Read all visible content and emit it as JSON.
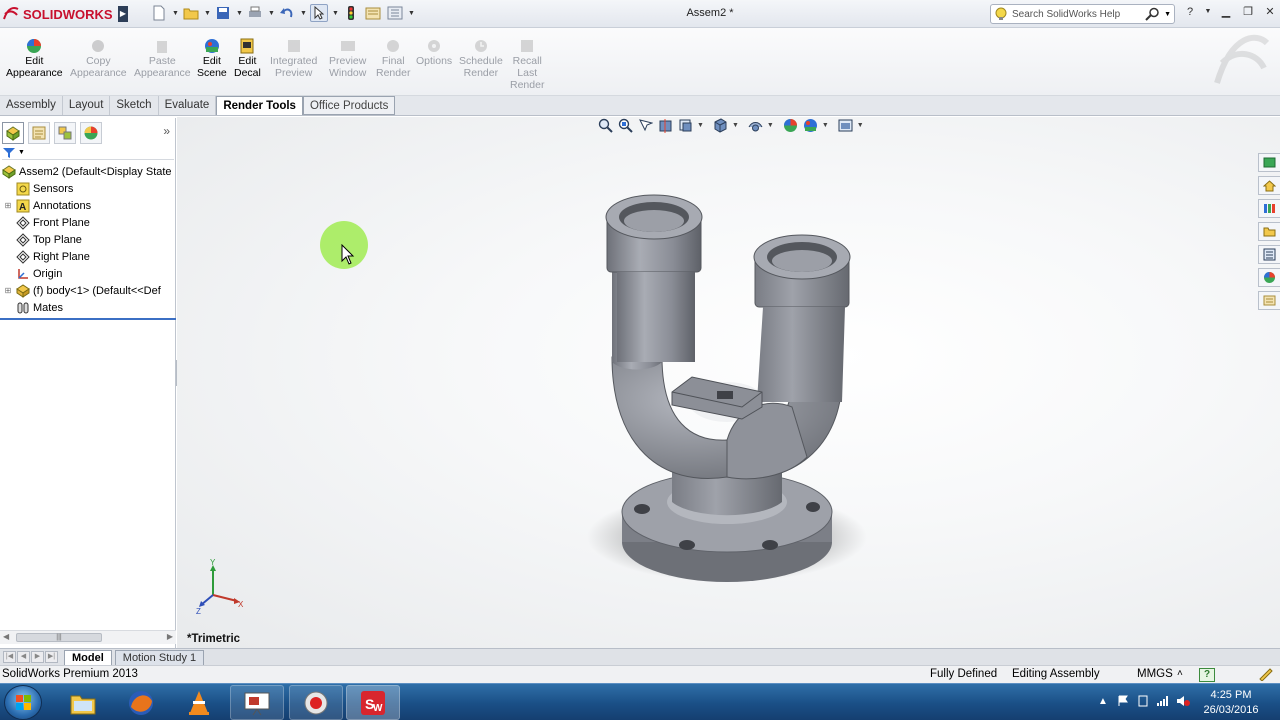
{
  "app": {
    "brand": "SOLIDWORKS",
    "window_title": "Assem2 *",
    "help_search_placeholder": "Search SolidWorks Help"
  },
  "command_manager": {
    "buttons": [
      {
        "label": "Edit\nAppearance",
        "l1": "Edit",
        "l2": "Appearance",
        "enabled": true
      },
      {
        "label": "Copy\nAppearance",
        "l1": "Copy",
        "l2": "Appearance",
        "enabled": false
      },
      {
        "label": "Paste\nAppearance",
        "l1": "Paste",
        "l2": "Appearance",
        "enabled": false
      },
      {
        "label": "Edit\nScene",
        "l1": "Edit",
        "l2": "Scene",
        "enabled": true
      },
      {
        "label": "Edit\nDecal",
        "l1": "Edit",
        "l2": "Decal",
        "enabled": true
      },
      {
        "label": "Integrated\nPreview",
        "l1": "Integrated",
        "l2": "Preview",
        "enabled": false
      },
      {
        "label": "Preview\nWindow",
        "l1": "Preview",
        "l2": "Window",
        "enabled": false
      },
      {
        "label": "Final\nRender",
        "l1": "Final",
        "l2": "Render",
        "enabled": false
      },
      {
        "label": "Options",
        "l1": "Options",
        "l2": "",
        "enabled": false
      },
      {
        "label": "Schedule\nRender",
        "l1": "Schedule",
        "l2": "Render",
        "enabled": false
      },
      {
        "label": "Recall\nLast\nRender",
        "l1": "Recall",
        "l2": "Last",
        "l3": "Render",
        "enabled": false
      }
    ]
  },
  "tabs": [
    "Assembly",
    "Layout",
    "Sketch",
    "Evaluate",
    "Render Tools",
    "Office Products"
  ],
  "active_tab": "Render Tools",
  "feature_tree": {
    "root": "Assem2  (Default<Display State",
    "items": [
      {
        "label": "Sensors",
        "icon": "sensors-icon",
        "expandable": false
      },
      {
        "label": "Annotations",
        "icon": "annotations-icon",
        "expandable": true
      },
      {
        "label": "Front Plane",
        "icon": "plane-icon",
        "expandable": false
      },
      {
        "label": "Top Plane",
        "icon": "plane-icon",
        "expandable": false
      },
      {
        "label": "Right Plane",
        "icon": "plane-icon",
        "expandable": false
      },
      {
        "label": "Origin",
        "icon": "origin-icon",
        "expandable": false
      },
      {
        "label": "(f) body<1> (Default<<Def",
        "icon": "part-icon",
        "expandable": true
      },
      {
        "label": "Mates",
        "icon": "mates-icon",
        "expandable": false
      }
    ]
  },
  "viewport": {
    "view_name": "*Trimetric",
    "triad_axes": {
      "x": "X",
      "y": "Y",
      "z": "Z"
    }
  },
  "bottom_tabs": [
    "Model",
    "Motion Study 1"
  ],
  "status_bar": {
    "product": "SolidWorks Premium 2013",
    "definition": "Fully Defined",
    "mode": "Editing Assembly",
    "units": "MMGS",
    "units_arrow": "˄",
    "help_badge": "?"
  },
  "taskbar": {
    "time": "4:25 PM",
    "date": "26/03/2016"
  },
  "colors": {
    "brand_red": "#c8102e",
    "model_gray": "#8a8d96",
    "cursor_highlight": "#96eb3c",
    "taskbar_blue": "#1a4f86"
  }
}
